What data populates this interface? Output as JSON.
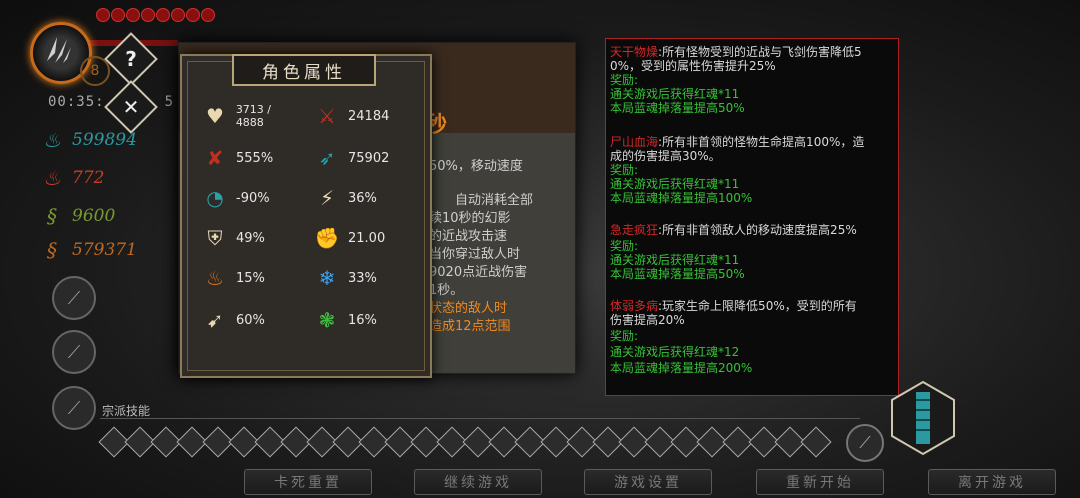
{
  "hud": {
    "timer": "00:35:",
    "timer_tail": "5",
    "help_label": "?",
    "close_label": "✕",
    "coin_label": "8",
    "resources": [
      {
        "icon": "blue-flame-icon",
        "color": "#2a9aa0",
        "value": "599894"
      },
      {
        "icon": "red-flame-icon",
        "color": "#c0402a",
        "value": "772"
      },
      {
        "icon": "green-swirl-icon",
        "color": "#7a9a30",
        "value": "9600"
      },
      {
        "icon": "orange-swirl-icon",
        "color": "#c06a20",
        "value": "579371"
      }
    ],
    "section_label": "宗派技能"
  },
  "bottom_buttons": [
    "卡死重置",
    "继续游戏",
    "游戏设置",
    "重新开始",
    "离开游戏"
  ],
  "skill_card": {
    "header_char": "秒",
    "lines": [
      {
        "text": "50%，移动速度",
        "cls": ""
      },
      {
        "text": "自动消耗全部",
        "cls": ""
      },
      {
        "text": "续10秒的幻影",
        "cls": ""
      },
      {
        "text": "的近战攻击速",
        "cls": ""
      },
      {
        "text": "当你穿过敌人时",
        "cls": ""
      },
      {
        "text": "9020点近战伤害",
        "cls": ""
      },
      {
        "text": "1秒。",
        "cls": ""
      },
      {
        "text": "状态的敌人时",
        "cls": "orange"
      },
      {
        "text": "造成12点范围",
        "cls": "orange"
      }
    ]
  },
  "attributes": {
    "title": "角色属性",
    "rows": [
      [
        {
          "icon": "heart-icon",
          "value": "3713 / 4888",
          "small": true
        },
        {
          "icon": "sword-attack-icon",
          "value": "24184"
        }
      ],
      [
        {
          "icon": "crit-sword-icon",
          "value": "555%"
        },
        {
          "icon": "ranged-attack-icon",
          "value": "75902"
        }
      ],
      [
        {
          "icon": "cooldown-icon",
          "value": "-90%"
        },
        {
          "icon": "shield-break-icon",
          "value": "36%"
        }
      ],
      [
        {
          "icon": "armor-shield-icon",
          "value": "49%"
        },
        {
          "icon": "damage-reduction-icon",
          "value": "21.00"
        }
      ],
      [
        {
          "icon": "fire-resist-icon",
          "value": "15%"
        },
        {
          "icon": "ice-resist-icon",
          "value": "33%"
        }
      ],
      [
        {
          "icon": "move-speed-icon",
          "value": "60%"
        },
        {
          "icon": "poison-resist-icon",
          "value": "16%"
        }
      ]
    ]
  },
  "modifiers": [
    {
      "name": "天干物燥",
      "desc1": ":所有怪物受到的近战与飞剑伤害降低5",
      "desc2": "0%，受到的属性伤害提升25%",
      "reward_label": "奖励:",
      "rewards": [
        "通关游戏后获得红魂*11",
        "本局蓝魂掉落量提高50%"
      ]
    },
    {
      "name": "尸山血海",
      "desc1": ":所有非首领的怪物生命提高100%，造",
      "desc2": "成的伤害提高30%。",
      "reward_label": "奖励:",
      "rewards": [
        "通关游戏后获得红魂*11",
        "本局蓝魂掉落量提高100%"
      ]
    },
    {
      "name": "急走疯狂",
      "desc1": ":所有非首领敌人的移动速度提高25%",
      "desc2": "",
      "reward_label": "奖励:",
      "rewards": [
        "通关游戏后获得红魂*11",
        "本局蓝魂掉落量提高50%"
      ]
    },
    {
      "name": "体弱多病",
      "desc1": ":玩家生命上限降低50%，受到的所有",
      "desc2": "伤害提高20%",
      "reward_label": "奖励:",
      "rewards": [
        "通关游戏后获得红魂*12",
        "本局蓝魂掉落量提高200%"
      ]
    }
  ]
}
